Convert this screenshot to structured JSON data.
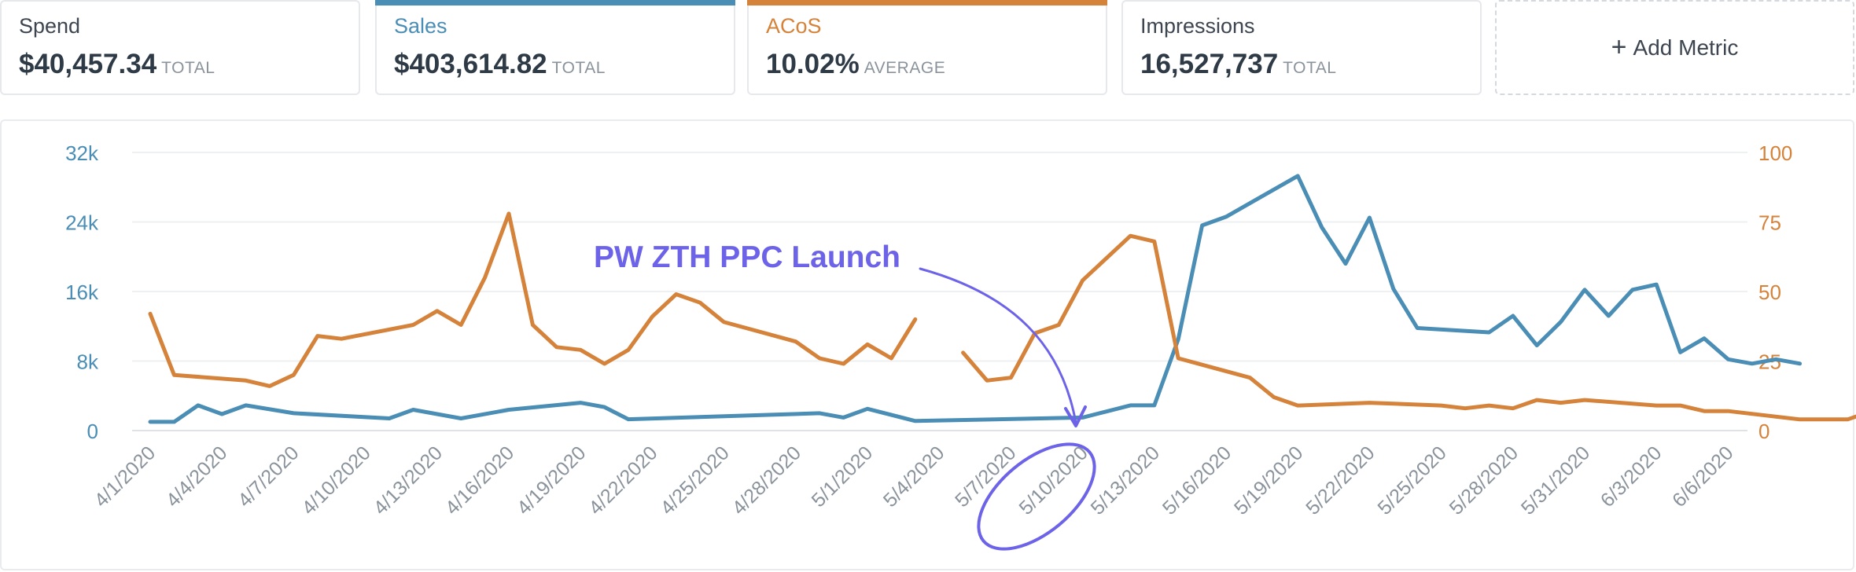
{
  "metrics": [
    {
      "label": "Spend",
      "value": "$40,457.34",
      "unit": "TOTAL",
      "color": "#3d4550",
      "accent": ""
    },
    {
      "label": "Sales",
      "value": "$403,614.82",
      "unit": "TOTAL",
      "color": "#4a8db5",
      "accent": "#4a8db5"
    },
    {
      "label": "ACoS",
      "value": "10.02%",
      "unit": "AVERAGE",
      "color": "#d5823a",
      "accent": "#d5823a"
    },
    {
      "label": "Impressions",
      "value": "16,527,737",
      "unit": "TOTAL",
      "color": "#3d4550",
      "accent": ""
    }
  ],
  "add_metric": {
    "icon": "plus-icon",
    "label": "Add Metric"
  },
  "annotation": {
    "text": "PW ZTH PPC Launch",
    "color": "#6c63e8"
  },
  "chart_data": {
    "type": "line",
    "x_tick_labels": [
      "4/1/2020",
      "4/4/2020",
      "4/7/2020",
      "4/10/2020",
      "4/13/2020",
      "4/16/2020",
      "4/19/2020",
      "4/22/2020",
      "4/25/2020",
      "4/28/2020",
      "5/1/2020",
      "5/4/2020",
      "5/7/2020",
      "5/10/2020",
      "5/13/2020",
      "5/16/2020",
      "5/19/2020",
      "5/22/2020",
      "5/25/2020",
      "5/28/2020",
      "5/31/2020",
      "6/3/2020",
      "6/6/2020"
    ],
    "left_axis": {
      "ticks": [
        "0",
        "8k",
        "16k",
        "24k",
        "32k"
      ],
      "range": [
        0,
        32000
      ],
      "color": "#4a8db5"
    },
    "right_axis": {
      "ticks": [
        "0",
        "25",
        "50",
        "75",
        "100"
      ],
      "range": [
        0,
        100
      ],
      "color": "#d5823a"
    },
    "grid": true,
    "series": [
      {
        "name": "Sales",
        "axis": "left",
        "color": "#4a8db5",
        "points": [
          [
            "4/1/2020",
            1000
          ],
          [
            "4/2/2020",
            1000
          ],
          [
            "4/3/2020",
            2900
          ],
          [
            "4/4/2020",
            1900
          ],
          [
            "4/5/2020",
            2900
          ],
          [
            "4/7/2020",
            2000
          ],
          [
            "4/11/2020",
            1400
          ],
          [
            "4/12/2020",
            2400
          ],
          [
            "4/14/2020",
            1400
          ],
          [
            "4/16/2020",
            2400
          ],
          [
            "4/19/2020",
            3200
          ],
          [
            "4/20/2020",
            2700
          ],
          [
            "4/21/2020",
            1300
          ],
          [
            "4/29/2020",
            2000
          ],
          [
            "4/30/2020",
            1500
          ],
          [
            "5/1/2020",
            2500
          ],
          [
            "5/3/2020",
            1100
          ],
          [
            "5/10/2020",
            1500
          ],
          [
            "5/11/2020",
            2200
          ],
          [
            "5/12/2020",
            2900
          ],
          [
            "5/13/2020",
            2900
          ],
          [
            "5/14/2020",
            10500
          ],
          [
            "5/15/2020",
            23600
          ],
          [
            "5/16/2020",
            24600
          ],
          [
            "5/19/2020",
            29300
          ],
          [
            "5/20/2020",
            23400
          ],
          [
            "5/21/2020",
            19200
          ],
          [
            "5/22/2020",
            24500
          ],
          [
            "5/23/2020",
            16300
          ],
          [
            "5/24/2020",
            11800
          ],
          [
            "5/27/2020",
            11300
          ],
          [
            "5/28/2020",
            13200
          ],
          [
            "5/29/2020",
            9800
          ],
          [
            "5/30/2020",
            12500
          ],
          [
            "5/31/2020",
            16200
          ],
          [
            "6/1/2020",
            13200
          ],
          [
            "6/2/2020",
            16200
          ],
          [
            "6/3/2020",
            16800
          ],
          [
            "6/4/2020",
            9000
          ],
          [
            "6/5/2020",
            10600
          ],
          [
            "6/6/2020",
            8200
          ],
          [
            "6/7/2020",
            7700
          ],
          [
            "6/8/2020",
            8200
          ],
          [
            "6/9/2020",
            7700
          ]
        ]
      },
      {
        "name": "ACoS",
        "axis": "right",
        "color": "#d5823a",
        "segments": [
          [
            [
              "4/1/2020",
              42
            ],
            [
              "4/2/2020",
              20
            ],
            [
              "4/5/2020",
              18
            ],
            [
              "4/6/2020",
              16
            ],
            [
              "4/7/2020",
              20
            ],
            [
              "4/8/2020",
              34
            ],
            [
              "4/9/2020",
              33
            ],
            [
              "4/12/2020",
              38
            ],
            [
              "4/13/2020",
              43
            ],
            [
              "4/14/2020",
              38
            ],
            [
              "4/15/2020",
              55
            ],
            [
              "4/16/2020",
              78
            ],
            [
              "4/17/2020",
              38
            ],
            [
              "4/18/2020",
              30
            ],
            [
              "4/19/2020",
              29
            ],
            [
              "4/20/2020",
              24
            ],
            [
              "4/21/2020",
              29
            ],
            [
              "4/22/2020",
              41
            ],
            [
              "4/23/2020",
              49
            ],
            [
              "4/24/2020",
              46
            ],
            [
              "4/25/2020",
              39
            ],
            [
              "4/28/2020",
              32
            ],
            [
              "4/29/2020",
              26
            ],
            [
              "4/30/2020",
              24
            ],
            [
              "5/1/2020",
              31
            ],
            [
              "5/2/2020",
              26
            ],
            [
              "5/3/2020",
              40
            ]
          ],
          [
            [
              "5/5/2020",
              28
            ],
            [
              "5/6/2020",
              18
            ],
            [
              "5/7/2020",
              19
            ],
            [
              "5/8/2020",
              35
            ],
            [
              "5/9/2020",
              38
            ],
            [
              "5/10/2020",
              54
            ],
            [
              "5/12/2020",
              70
            ],
            [
              "5/13/2020",
              68
            ],
            [
              "5/14/2020",
              26
            ],
            [
              "5/17/2020",
              19
            ],
            [
              "5/18/2020",
              12
            ],
            [
              "5/19/2020",
              9
            ],
            [
              "5/22/2020",
              10
            ],
            [
              "5/25/2020",
              9
            ],
            [
              "5/26/2020",
              8
            ],
            [
              "5/27/2020",
              9
            ],
            [
              "5/28/2020",
              8
            ],
            [
              "5/29/2020",
              11
            ],
            [
              "5/30/2020",
              10
            ],
            [
              "5/31/2020",
              11
            ],
            [
              "6/3/2020",
              9
            ],
            [
              "6/4/2020",
              9
            ],
            [
              "6/5/2020",
              7
            ],
            [
              "6/6/2020",
              7
            ],
            [
              "6/9/2020",
              4
            ],
            [
              "6/11/2020",
              4
            ],
            [
              "6/12/2020",
              7
            ]
          ]
        ]
      }
    ]
  }
}
